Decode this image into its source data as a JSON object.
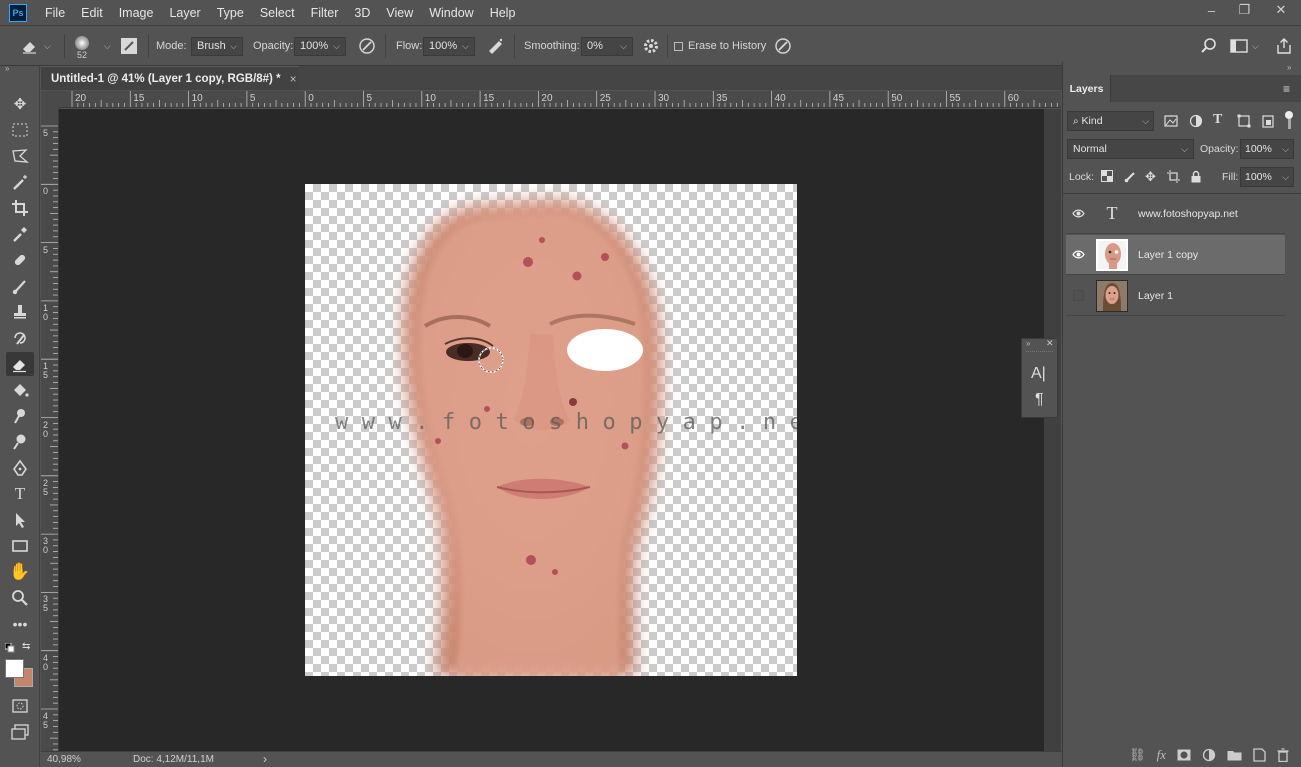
{
  "app": {
    "logo": "Ps"
  },
  "menu": [
    "File",
    "Edit",
    "Image",
    "Layer",
    "Type",
    "Select",
    "Filter",
    "3D",
    "View",
    "Window",
    "Help"
  ],
  "options": {
    "brush_size": "52",
    "mode_label": "Mode:",
    "mode_value": "Brush",
    "opacity_label": "Opacity:",
    "opacity_value": "100%",
    "flow_label": "Flow:",
    "flow_value": "100%",
    "smoothing_label": "Smoothing:",
    "smoothing_value": "0%",
    "erase_history_label": "Erase to History",
    "erase_history_checked": false
  },
  "document": {
    "tab_title": "Untitled-1 @ 41% (Layer 1 copy, RGB/8#) *",
    "close_glyph": "×",
    "watermark_text": "www.fotoshopyap.net"
  },
  "rulers": {
    "top": [
      "20",
      "15",
      "10",
      "5",
      "0",
      "5",
      "10",
      "15",
      "20",
      "25",
      "30",
      "35",
      "40",
      "45",
      "50",
      "55",
      "60"
    ],
    "left": [
      "5",
      "0",
      "5",
      "1\n0",
      "1\n5",
      "2\n0",
      "2\n5",
      "3\n0",
      "3\n5",
      "4\n0",
      "4\n5"
    ]
  },
  "status": {
    "zoom": "40,98%",
    "doc": "Doc: 4,12M/11,1M"
  },
  "layers_panel": {
    "tab": "Layers",
    "filter_kind": "Kind",
    "blend_mode": "Normal",
    "opacity_label": "Opacity:",
    "opacity_value": "100%",
    "lock_label": "Lock:",
    "fill_label": "Fill:",
    "fill_value": "100%",
    "layers": [
      {
        "name": "www.fotoshopyap.net",
        "type": "text",
        "visible": true,
        "selected": false
      },
      {
        "name": "Layer 1 copy",
        "type": "pixel",
        "visible": true,
        "selected": true
      },
      {
        "name": "Layer 1",
        "type": "pixel",
        "visible": false,
        "selected": false
      }
    ]
  },
  "char_panel": {
    "char_icon": "A|",
    "para_icon": "¶"
  },
  "colors": {
    "foreground": "#ffffff",
    "background": "#c4866a",
    "accent": "#31a8ff"
  }
}
